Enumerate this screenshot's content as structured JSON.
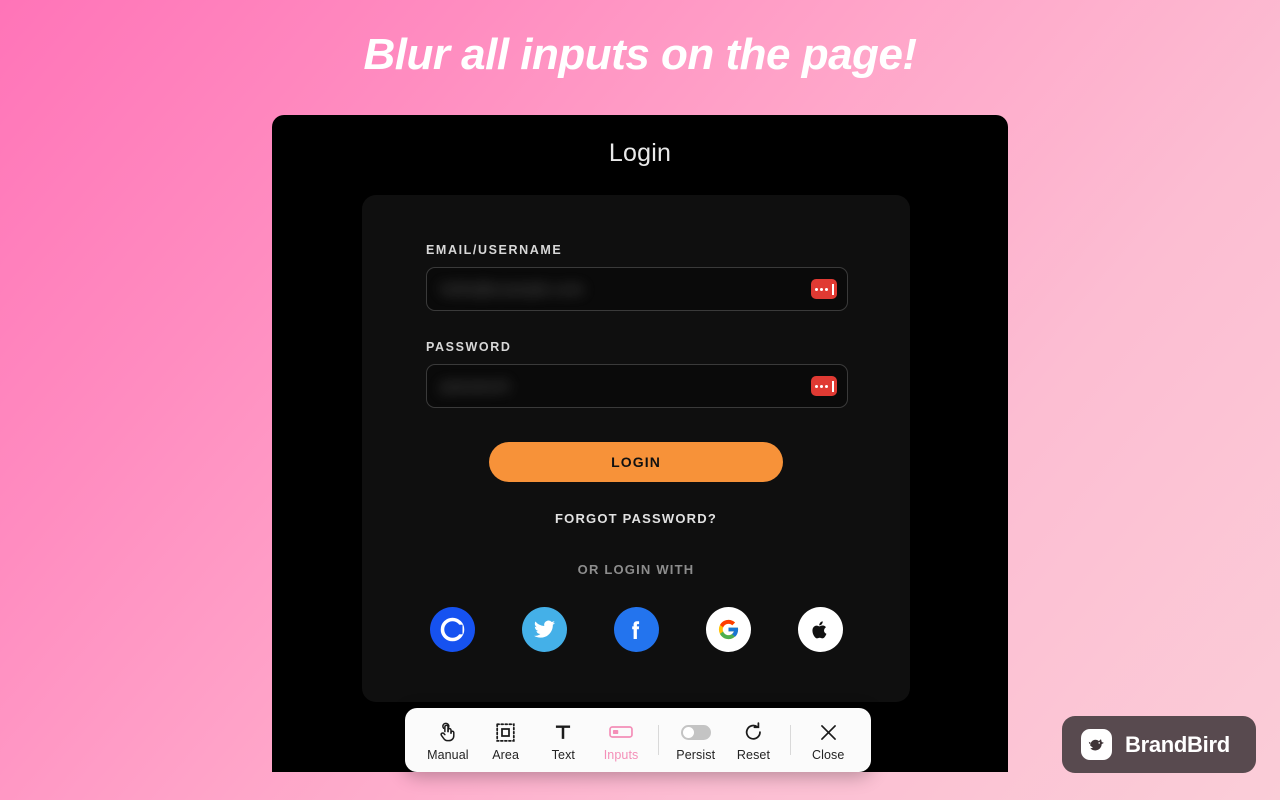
{
  "headline": "Blur all inputs on the page!",
  "colors": {
    "bg_gradient_from": "#ff74b8",
    "bg_gradient_to": "#fbcdd8",
    "window_bg": "#000000",
    "card_bg": "#0f0f0f",
    "accent_button": "#f79239",
    "badge_red": "#e03a33",
    "active_tool_pink": "#f48fb8",
    "toolbar_bg": "#fbfbfb",
    "watermark_bg": "#584a4f"
  },
  "window": {
    "title": "Login"
  },
  "login": {
    "email": {
      "label": "EMAIL/USERNAME",
      "value": "hello@example.com",
      "badge_icon": "password-dots-badge"
    },
    "password": {
      "label": "PASSWORD",
      "value": "password",
      "badge_icon": "password-dots-badge"
    },
    "submit_label": "LOGIN",
    "forgot_label": "FORGOT PASSWORD?",
    "or_label": "OR LOGIN WITH",
    "social": [
      {
        "name": "coinbase",
        "icon": "coinbase-icon"
      },
      {
        "name": "twitter",
        "icon": "twitter-icon"
      },
      {
        "name": "facebook",
        "icon": "facebook-icon"
      },
      {
        "name": "google",
        "icon": "google-icon"
      },
      {
        "name": "apple",
        "icon": "apple-icon"
      }
    ]
  },
  "toolbar": {
    "tools": [
      {
        "label": "Manual",
        "icon": "hand-tap-icon",
        "active": false
      },
      {
        "label": "Area",
        "icon": "dotted-selection-icon",
        "active": false
      },
      {
        "label": "Text",
        "icon": "text-t-icon",
        "active": false
      },
      {
        "label": "Inputs",
        "icon": "input-field-icon",
        "active": true
      }
    ],
    "persist": {
      "label": "Persist",
      "icon": "toggle-switch-icon",
      "state": "off"
    },
    "reset": {
      "label": "Reset",
      "icon": "refresh-circular-arrow-icon"
    },
    "close": {
      "label": "Close",
      "icon": "close-x-icon"
    }
  },
  "watermark": {
    "label": "BrandBird",
    "icon": "brandbird-logo-icon"
  }
}
